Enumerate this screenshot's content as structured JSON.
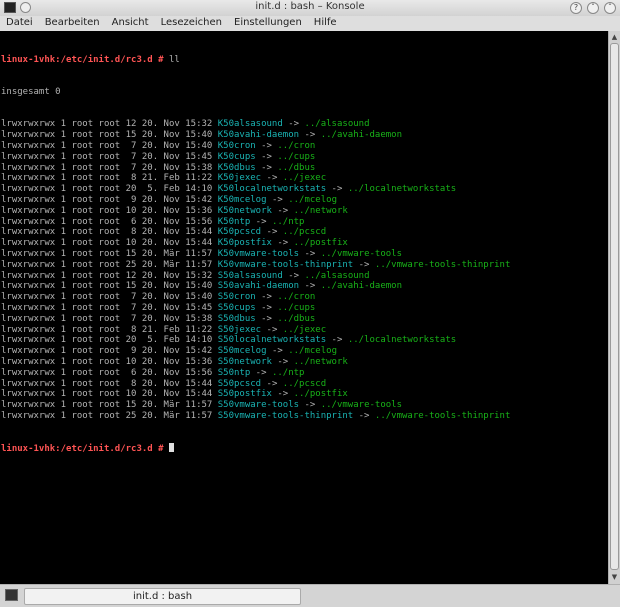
{
  "window": {
    "title": "init.d : bash – Konsole",
    "controls": [
      "help-icon",
      "minimize-icon",
      "maximize-icon",
      "close-icon"
    ]
  },
  "menu": [
    "Datei",
    "Bearbeiten",
    "Ansicht",
    "Lesezeichen",
    "Einstellungen",
    "Hilfe"
  ],
  "terminal": {
    "prompt": "linux-1vhk:/etc/init.d/rc3.d #",
    "command": " ll",
    "total": "insgesamt 0",
    "entries": [
      {
        "meta": "lrwxrwxrwx 1 root root 12 20. Nov 15:32 ",
        "name": "K50alsasound",
        "target": "../alsasound"
      },
      {
        "meta": "lrwxrwxrwx 1 root root 15 20. Nov 15:40 ",
        "name": "K50avahi-daemon",
        "target": "../avahi-daemon"
      },
      {
        "meta": "lrwxrwxrwx 1 root root  7 20. Nov 15:40 ",
        "name": "K50cron",
        "target": "../cron"
      },
      {
        "meta": "lrwxrwxrwx 1 root root  7 20. Nov 15:45 ",
        "name": "K50cups",
        "target": "../cups"
      },
      {
        "meta": "lrwxrwxrwx 1 root root  7 20. Nov 15:38 ",
        "name": "K50dbus",
        "target": "../dbus"
      },
      {
        "meta": "lrwxrwxrwx 1 root root  8 21. Feb 11:22 ",
        "name": "K50jexec",
        "target": "../jexec"
      },
      {
        "meta": "lrwxrwxrwx 1 root root 20  5. Feb 14:10 ",
        "name": "K50localnetworkstats",
        "target": "../localnetworkstats"
      },
      {
        "meta": "lrwxrwxrwx 1 root root  9 20. Nov 15:42 ",
        "name": "K50mcelog",
        "target": "../mcelog"
      },
      {
        "meta": "lrwxrwxrwx 1 root root 10 20. Nov 15:36 ",
        "name": "K50network",
        "target": "../network"
      },
      {
        "meta": "lrwxrwxrwx 1 root root  6 20. Nov 15:56 ",
        "name": "K50ntp",
        "target": "../ntp"
      },
      {
        "meta": "lrwxrwxrwx 1 root root  8 20. Nov 15:44 ",
        "name": "K50pcscd",
        "target": "../pcscd"
      },
      {
        "meta": "lrwxrwxrwx 1 root root 10 20. Nov 15:44 ",
        "name": "K50postfix",
        "target": "../postfix"
      },
      {
        "meta": "lrwxrwxrwx 1 root root 15 20. Mär 11:57 ",
        "name": "K50vmware-tools",
        "target": "../vmware-tools"
      },
      {
        "meta": "lrwxrwxrwx 1 root root 25 20. Mär 11:57 ",
        "name": "K50vmware-tools-thinprint",
        "target": "../vmware-tools-thinprint"
      },
      {
        "meta": "lrwxrwxrwx 1 root root 12 20. Nov 15:32 ",
        "name": "S50alsasound",
        "target": "../alsasound"
      },
      {
        "meta": "lrwxrwxrwx 1 root root 15 20. Nov 15:40 ",
        "name": "S50avahi-daemon",
        "target": "../avahi-daemon"
      },
      {
        "meta": "lrwxrwxrwx 1 root root  7 20. Nov 15:40 ",
        "name": "S50cron",
        "target": "../cron"
      },
      {
        "meta": "lrwxrwxrwx 1 root root  7 20. Nov 15:45 ",
        "name": "S50cups",
        "target": "../cups"
      },
      {
        "meta": "lrwxrwxrwx 1 root root  7 20. Nov 15:38 ",
        "name": "S50dbus",
        "target": "../dbus"
      },
      {
        "meta": "lrwxrwxrwx 1 root root  8 21. Feb 11:22 ",
        "name": "S50jexec",
        "target": "../jexec"
      },
      {
        "meta": "lrwxrwxrwx 1 root root 20  5. Feb 14:10 ",
        "name": "S50localnetworkstats",
        "target": "../localnetworkstats"
      },
      {
        "meta": "lrwxrwxrwx 1 root root  9 20. Nov 15:42 ",
        "name": "S50mcelog",
        "target": "../mcelog"
      },
      {
        "meta": "lrwxrwxrwx 1 root root 10 20. Nov 15:36 ",
        "name": "S50network",
        "target": "../network"
      },
      {
        "meta": "lrwxrwxrwx 1 root root  6 20. Nov 15:56 ",
        "name": "S50ntp",
        "target": "../ntp"
      },
      {
        "meta": "lrwxrwxrwx 1 root root  8 20. Nov 15:44 ",
        "name": "S50pcscd",
        "target": "../pcscd"
      },
      {
        "meta": "lrwxrwxrwx 1 root root 10 20. Nov 15:44 ",
        "name": "S50postfix",
        "target": "../postfix"
      },
      {
        "meta": "lrwxrwxrwx 1 root root 15 20. Mär 11:57 ",
        "name": "S50vmware-tools",
        "target": "../vmware-tools"
      },
      {
        "meta": "lrwxrwxrwx 1 root root 25 20. Mär 11:57 ",
        "name": "S50vmware-tools-thinprint",
        "target": "../vmware-tools-thinprint"
      }
    ],
    "arrow": " -> "
  },
  "tabs": [
    {
      "label": "init.d : bash"
    }
  ],
  "colors": {
    "background": "#000000",
    "prompt": "#ff5454",
    "symlink": "#1ab3b3",
    "target": "#18b218",
    "text": "#b3b3b3"
  }
}
